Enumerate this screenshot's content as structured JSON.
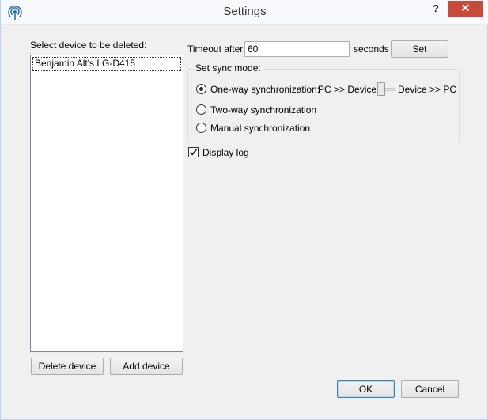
{
  "window": {
    "title": "Settings",
    "help_label": "?",
    "close_label": "✕"
  },
  "devices": {
    "list_label": "Select device to be deleted:",
    "items": [
      "Benjamin Alt's LG-D415"
    ],
    "delete_label": "Delete device",
    "add_label": "Add device"
  },
  "timeout": {
    "label": "Timeout after",
    "value": "60",
    "unit": "seconds",
    "set_label": "Set"
  },
  "sync": {
    "group_title": "Set sync mode:",
    "options": [
      {
        "label": "One-way synchronization:",
        "selected": true
      },
      {
        "label": "Two-way synchronization",
        "selected": false
      },
      {
        "label": "Manual synchronization",
        "selected": false
      }
    ],
    "direction_left": "PC >> Device",
    "direction_right": "Device >> PC",
    "direction_value": 0
  },
  "log": {
    "label": "Display log",
    "checked": true
  },
  "footer": {
    "ok_label": "OK",
    "cancel_label": "Cancel"
  },
  "colors": {
    "close_button": "#c74a3a",
    "default_button_border": "#3c7fb1"
  }
}
